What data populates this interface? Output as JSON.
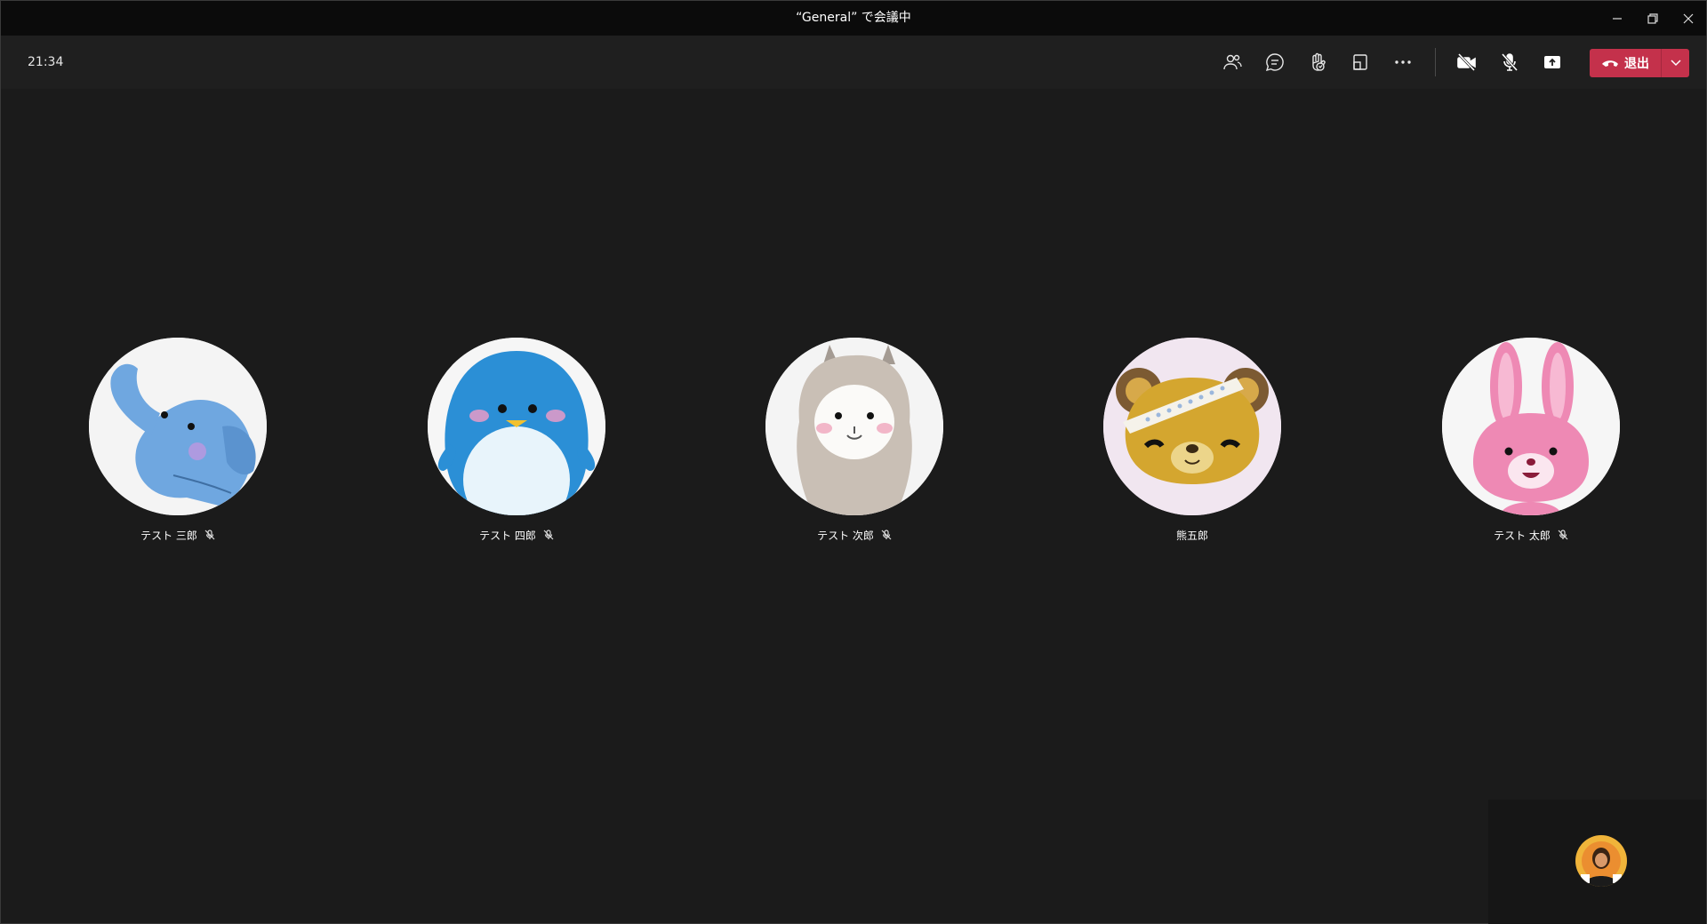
{
  "window": {
    "title": "“General” で会議中"
  },
  "toolbar": {
    "clock": "21:34",
    "buttons": [
      {
        "icon": "participants-icon"
      },
      {
        "icon": "chat-icon"
      },
      {
        "icon": "raise-hand-icon"
      },
      {
        "icon": "breakout-icon"
      },
      {
        "icon": "more-icon"
      },
      {
        "icon": "camera-off-icon"
      },
      {
        "icon": "mic-off-icon"
      },
      {
        "icon": "share-icon"
      }
    ],
    "leave_label": "退出"
  },
  "participants": [
    {
      "name": "テスト 三郎",
      "muted": true,
      "avatar": "elephant"
    },
    {
      "name": "テスト 四郎",
      "muted": true,
      "avatar": "penguin"
    },
    {
      "name": "テスト 次郎",
      "muted": true,
      "avatar": "alpaca"
    },
    {
      "name": "熊五郎",
      "muted": false,
      "avatar": "bear"
    },
    {
      "name": "テスト 太郎",
      "muted": true,
      "avatar": "rabbit"
    }
  ],
  "colors": {
    "background": "#1b1b1b",
    "titlebar": "#0b0b0b",
    "toolbar": "#1f1f1f",
    "leave": "#c4314b"
  }
}
